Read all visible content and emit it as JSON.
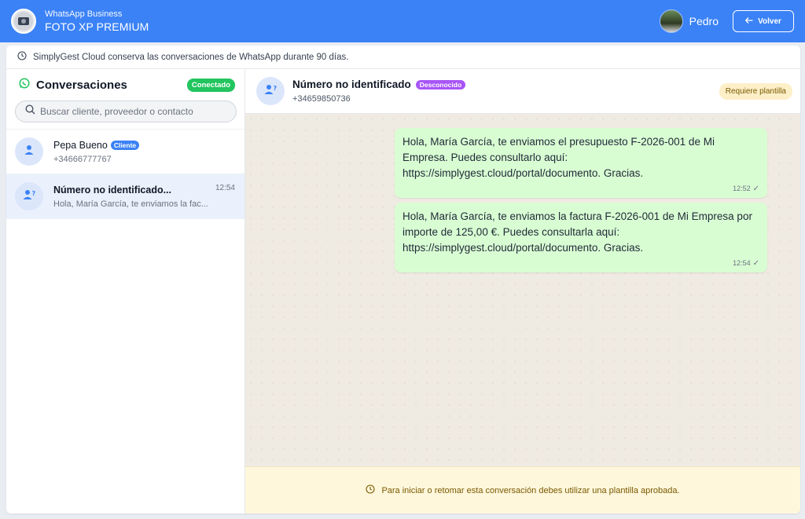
{
  "header": {
    "app_name": "WhatsApp Business",
    "company": "FOTO XP PREMIUM",
    "user_name": "Pedro",
    "back_label": "Volver"
  },
  "notice": {
    "text": "SimplyGest Cloud conserva las conversaciones de WhatsApp durante 90 días."
  },
  "sidebar": {
    "title": "Conversaciones",
    "status": "Conectado",
    "search_placeholder": "Buscar cliente, proveedor o contacto",
    "conversations": [
      {
        "name": "Pepa Bueno",
        "tag": "Cliente",
        "subtitle": "+34666777767",
        "time": ""
      },
      {
        "name": "Número no identificado...",
        "tag": "",
        "subtitle": "Hola, María García, te enviamos la fac...",
        "time": "12:54"
      }
    ]
  },
  "chat": {
    "contact_name": "Número no identificado",
    "contact_tag": "Desconocido",
    "contact_phone": "+34659850736",
    "template_badge": "Requiere plantilla",
    "messages": [
      {
        "text": "Hola, María García, te enviamos el presupuesto F-2026-001 de Mi Empresa. Puedes consultarlo aquí: https://simplygest.cloud/portal/documento. Gracias.",
        "time": "12:52"
      },
      {
        "text": "Hola, María García, te enviamos la factura F-2026-001 de Mi Empresa por importe de 125,00 €. Puedes consultarla aquí: https://simplygest.cloud/portal/documento. Gracias.",
        "time": "12:54"
      }
    ],
    "footer_warning": "Para iniciar o retomar esta conversación debes utilizar una plantilla aprobada."
  },
  "colors": {
    "header": "#3b82f6",
    "connected": "#22c55e",
    "client_tag": "#3b82f6",
    "unknown_tag": "#a855f7",
    "bubble": "#d9fdd3",
    "chat_bg": "#efeae2"
  }
}
